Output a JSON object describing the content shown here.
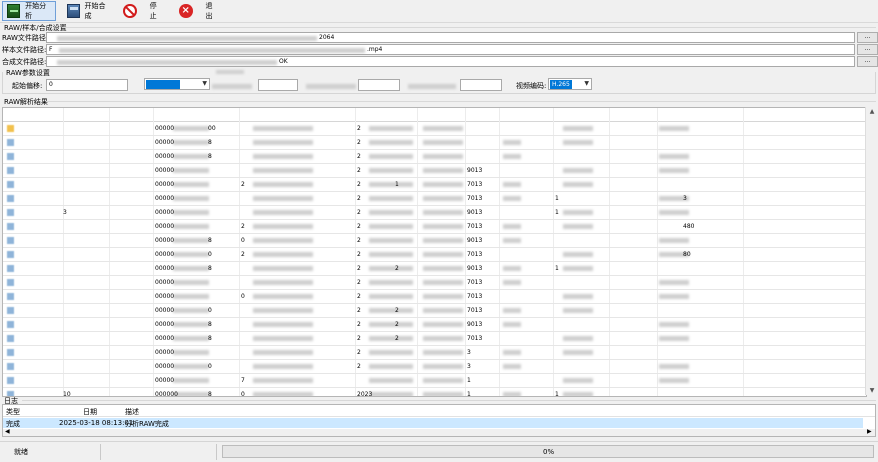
{
  "toolbar": {
    "start_analysis": "开始分析",
    "start_merge": "开始合成",
    "stop": "停止",
    "exit": "退出"
  },
  "raw_group": {
    "title": "RAW/样本/合成设置",
    "raw_label": "RAW文件路径:",
    "raw_value_tail": "2064",
    "sample_label": "样本文件路径:",
    "sample_value_head": "F",
    "sample_value_tail": ".mp4",
    "output_label": "合成文件路径:",
    "output_value_tail": "OK",
    "browse_label": "..."
  },
  "params": {
    "title": "RAW参数设置",
    "offset_label": "起始偏移:",
    "offset_value": "0",
    "codec_label": "视频编码:",
    "codec_value": "H.265"
  },
  "results": {
    "title": "RAW解析结果",
    "rows": [
      {
        "c1": "",
        "c2": "",
        "c3": "00000",
        "c3b": "00",
        "c4": "",
        "c5": "2",
        "c6": "",
        "c7": "",
        "c8": "",
        "c9": "",
        "c10": ""
      },
      {
        "c1": "",
        "c2": "",
        "c3": "00000",
        "c3b": "8",
        "c4": "",
        "c5": "2",
        "c6": "",
        "c7": "",
        "c8": "",
        "c9": "",
        "c10": ""
      },
      {
        "c1": "",
        "c2": "",
        "c3": "00000",
        "c3b": "8",
        "c4": "",
        "c5": "2",
        "c6": "",
        "c7": "",
        "c8": "",
        "c9": "",
        "c10": ""
      },
      {
        "c1": "",
        "c2": "",
        "c3": "00000",
        "c3b": "",
        "c4": "",
        "c5": "2",
        "c6": "",
        "c7": "9013",
        "c8": "",
        "c9": "",
        "c10": ""
      },
      {
        "c1": "",
        "c2": "",
        "c3": "00000",
        "c3b": "",
        "c4": "2",
        "c5": "2",
        "c6": "1",
        "c7": "7013",
        "c8": "",
        "c9": "",
        "c10": ""
      },
      {
        "c1": "",
        "c2": "",
        "c3": "00000",
        "c3b": "",
        "c4": "",
        "c5": "2",
        "c6": "",
        "c7": "7013",
        "c8": "",
        "c9": "1",
        "c10": "3"
      },
      {
        "c1": "",
        "c2": "3",
        "c3": "00000",
        "c3b": "",
        "c4": "",
        "c5": "2",
        "c6": "",
        "c7": "9013",
        "c8": "",
        "c9": "1",
        "c10": ""
      },
      {
        "c1": "",
        "c2": "",
        "c3": "00000",
        "c3b": "",
        "c4": "2",
        "c5": "2",
        "c6": "",
        "c7": "7013",
        "c8": "",
        "c9": "",
        "c10": "480"
      },
      {
        "c1": "",
        "c2": "",
        "c3": "00000",
        "c3b": "8",
        "c4": "0",
        "c5": "2",
        "c6": "",
        "c7": "9013",
        "c8": "",
        "c9": "",
        "c10": ""
      },
      {
        "c1": "",
        "c2": "",
        "c3": "00000",
        "c3b": "0",
        "c4": "2",
        "c5": "2",
        "c6": "",
        "c7": "7013",
        "c8": "",
        "c9": "",
        "c10": "80"
      },
      {
        "c1": "",
        "c2": "",
        "c3": "00000",
        "c3b": "8",
        "c4": "",
        "c5": "2",
        "c6": "2",
        "c7": "9013",
        "c8": "",
        "c9": "1",
        "c10": ""
      },
      {
        "c1": "",
        "c2": "",
        "c3": "00000",
        "c3b": "",
        "c4": "",
        "c5": "2",
        "c6": "",
        "c7": "7013",
        "c8": "",
        "c9": "",
        "c10": ""
      },
      {
        "c1": "",
        "c2": "",
        "c3": "00000",
        "c3b": "",
        "c4": "0",
        "c5": "2",
        "c6": "",
        "c7": "7013",
        "c8": "",
        "c9": "",
        "c10": ""
      },
      {
        "c1": "",
        "c2": "",
        "c3": "00000",
        "c3b": "0",
        "c4": "",
        "c5": "2",
        "c6": "2",
        "c7": "7013",
        "c8": "",
        "c9": "",
        "c10": ""
      },
      {
        "c1": "",
        "c2": "",
        "c3": "00000",
        "c3b": "8",
        "c4": "",
        "c5": "2",
        "c6": "2",
        "c7": "9013",
        "c8": "",
        "c9": "",
        "c10": ""
      },
      {
        "c1": "",
        "c2": "",
        "c3": "00000",
        "c3b": "8",
        "c4": "",
        "c5": "2",
        "c6": "2",
        "c7": "7013",
        "c8": "",
        "c9": "",
        "c10": ""
      },
      {
        "c1": "",
        "c2": "",
        "c3": "00000",
        "c3b": "",
        "c4": "",
        "c5": "2",
        "c6": "",
        "c7": "3",
        "c8": "",
        "c9": "",
        "c10": ""
      },
      {
        "c1": "",
        "c2": "",
        "c3": "00000",
        "c3b": "0",
        "c4": "",
        "c5": "2",
        "c6": "",
        "c7": "3",
        "c8": "",
        "c9": "",
        "c10": ""
      },
      {
        "c1": "",
        "c2": "",
        "c3": "00000",
        "c3b": "",
        "c4": "7",
        "c5": "",
        "c6": "",
        "c7": "1",
        "c8": "",
        "c9": "",
        "c10": ""
      },
      {
        "c1": "",
        "c2": "10",
        "c3": "000000",
        "c3b": "8",
        "c4": "0",
        "c5": "2023",
        "c6": "",
        "c7": "1",
        "c8": "",
        "c9": "1",
        "c10": ""
      }
    ]
  },
  "log": {
    "title": "日志",
    "col_type": "类型",
    "col_date": "日期",
    "col_desc": "描述",
    "entry_type": "完成",
    "entry_date": "2025-03-18 08:13:01",
    "entry_desc": "分析RAW完成"
  },
  "status": {
    "text": "就绪",
    "progress_label": "0%",
    "progress": 0
  },
  "colors": {
    "selection": "#0078d7",
    "log_highlight": "#cce8ff",
    "toolbar_active": "#dbe8f7"
  }
}
